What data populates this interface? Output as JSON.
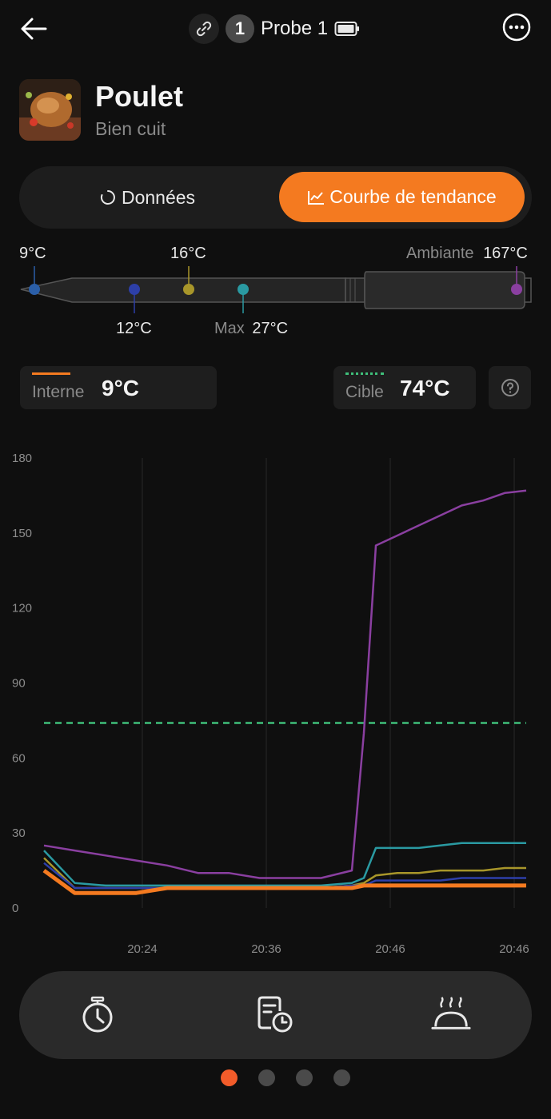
{
  "header": {
    "probe_number": "1",
    "probe_name": "Probe 1"
  },
  "food": {
    "name": "Poulet",
    "doneness": "Bien cuit"
  },
  "tabs": {
    "data_label": "Données",
    "trend_label": "Courbe de tendance",
    "active": "trend"
  },
  "probe_sensors": {
    "tip": "9°C",
    "sensor2": "12°C",
    "sensor3": "16°C",
    "max_label": "Max",
    "max_value": "27°C",
    "ambient_label": "Ambiante",
    "ambient_value": "167°C"
  },
  "readings": {
    "internal_label": "Interne",
    "internal_value": "9°C",
    "target_label": "Cible",
    "target_value": "74°C"
  },
  "colors": {
    "accent": "#f47a20",
    "internal": "#f47a20",
    "tip": "#2b5fa8",
    "sensor2": "#2d3fa8",
    "sensor3": "#a8962a",
    "max": "#2a9aa2",
    "ambient": "#8a3fa0",
    "target": "#3fbf7a"
  },
  "chart_data": {
    "type": "line",
    "ylim": [
      0,
      180
    ],
    "yticks": [
      "0",
      "30",
      "60",
      "90",
      "120",
      "150",
      "180"
    ],
    "xticks": [
      "20:24",
      "20:36",
      "20:46",
      "20:46"
    ],
    "target_line": 74,
    "series": [
      {
        "id": "ambient",
        "color": "#8a3fa0",
        "values": [
          25,
          23,
          21,
          19,
          17,
          14,
          14,
          12,
          12,
          12,
          15,
          70,
          145,
          149,
          153,
          157,
          161,
          163,
          166,
          167
        ]
      },
      {
        "id": "max",
        "color": "#2a9aa2",
        "values": [
          23,
          10,
          9,
          9,
          9,
          9,
          9,
          9,
          9,
          9,
          10,
          12,
          24,
          24,
          24,
          25,
          26,
          26,
          26,
          26
        ]
      },
      {
        "id": "sensor3",
        "color": "#a8962a",
        "values": [
          20,
          8,
          8,
          8,
          8,
          8,
          8,
          8,
          8,
          8,
          9,
          10,
          13,
          14,
          14,
          15,
          15,
          15,
          16,
          16
        ]
      },
      {
        "id": "sensor2",
        "color": "#2d3fa8",
        "values": [
          18,
          8,
          8,
          8,
          8,
          8,
          8,
          8,
          8,
          8,
          9,
          9,
          11,
          11,
          11,
          11,
          12,
          12,
          12,
          12
        ]
      },
      {
        "id": "internal",
        "color": "#f47a20",
        "values": [
          15,
          6,
          6,
          6,
          8,
          8,
          8,
          8,
          8,
          8,
          8,
          9,
          9,
          9,
          9,
          9,
          9,
          9,
          9,
          9
        ]
      }
    ]
  },
  "bottom_nav": {
    "items": [
      "timer-icon",
      "history-icon",
      "cooking-icon"
    ]
  },
  "pager": {
    "count": 4,
    "active_index": 0
  }
}
